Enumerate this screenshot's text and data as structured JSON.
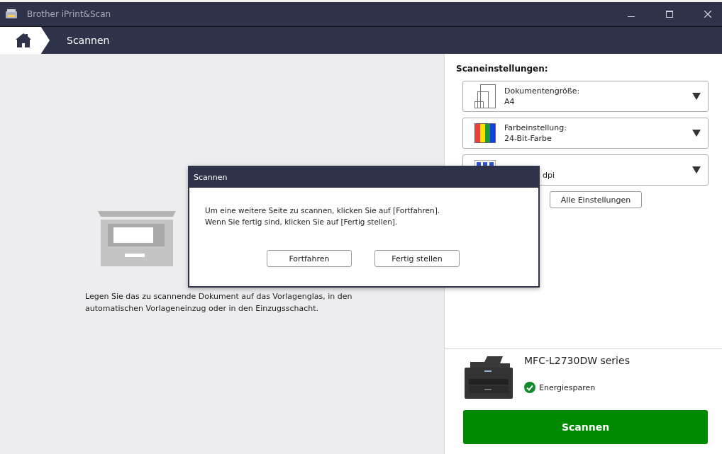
{
  "window": {
    "title": "Brother iPrint&Scan"
  },
  "breadcrumb": {
    "label": "Scannen"
  },
  "instructions": "Legen Sie das zu scannende Dokument auf das Vorlagenglas, in den automatischen Vorlageneinzug oder in den Einzugsschacht.",
  "settings": {
    "heading": "Scaneinstellungen:",
    "dropdowns": [
      {
        "kind": "size",
        "label": "Dokumentengröße:",
        "value": "A4",
        "covered": false
      },
      {
        "kind": "color",
        "label": "Farbeinstellung:",
        "value": "24-Bit-Farbe",
        "covered": false
      },
      {
        "kind": "resolution",
        "value": "dpi",
        "covered": true
      }
    ],
    "all_button": "Alle Einstellungen"
  },
  "device": {
    "name": "MFC-L2730DW series",
    "status": "Energiesparen",
    "ok": true
  },
  "scan_button": "Scannen",
  "dialog": {
    "title": "Scannen",
    "message": [
      "Um eine weitere Seite zu scannen, klicken Sie auf [Fortfahren].",
      "Wenn Sie fertig sind, klicken Sie auf [Fertig stellen]."
    ],
    "buttons": [
      "Fortfahren",
      "Fertig stellen"
    ]
  }
}
